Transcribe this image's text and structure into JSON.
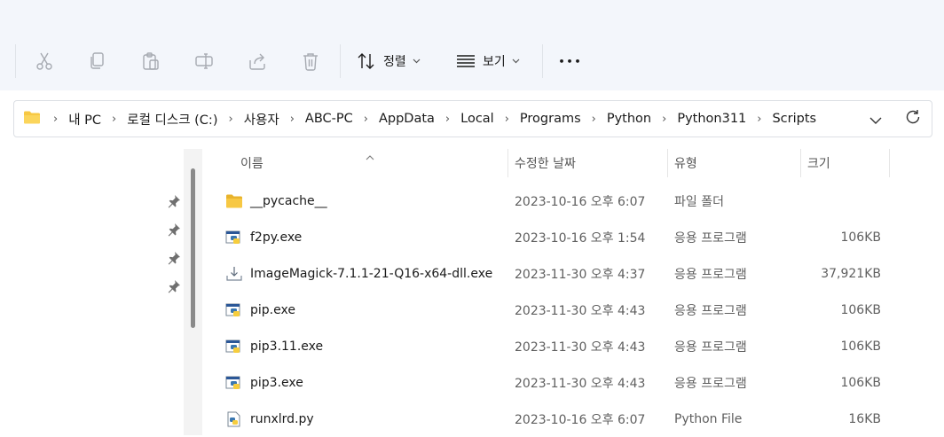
{
  "toolbar": {
    "cut_icon": "scissors-icon",
    "copy_icon": "copy-icon",
    "paste_icon": "clipboard-icon",
    "rename_icon": "rename-icon",
    "share_icon": "share-icon",
    "delete_icon": "trash-icon",
    "sort_label": "정렬",
    "view_label": "보기",
    "more_label": "•••"
  },
  "address": {
    "crumbs": [
      "내 PC",
      "로컬 디스크 (C:)",
      "사용자",
      "ABC-PC",
      "AppData",
      "Local",
      "Programs",
      "Python",
      "Python311",
      "Scripts"
    ],
    "separator": "›"
  },
  "columns": {
    "name": "이름",
    "date": "수정한 날짜",
    "type": "유형",
    "size": "크기"
  },
  "files": [
    {
      "name": "__pycache__",
      "date": "2023-10-16 오후 6:07",
      "type": "파일 폴더",
      "size": "",
      "icon": "folder-icon"
    },
    {
      "name": "f2py.exe",
      "date": "2023-10-16 오후 1:54",
      "type": "응용 프로그램",
      "size": "106KB",
      "icon": "python-exe-icon"
    },
    {
      "name": "ImageMagick-7.1.1-21-Q16-x64-dll.exe",
      "date": "2023-11-30 오후 4:37",
      "type": "응용 프로그램",
      "size": "37,921KB",
      "icon": "installer-icon"
    },
    {
      "name": "pip.exe",
      "date": "2023-11-30 오후 4:43",
      "type": "응용 프로그램",
      "size": "106KB",
      "icon": "python-exe-icon"
    },
    {
      "name": "pip3.11.exe",
      "date": "2023-11-30 오후 4:43",
      "type": "응용 프로그램",
      "size": "106KB",
      "icon": "python-exe-icon"
    },
    {
      "name": "pip3.exe",
      "date": "2023-11-30 오후 4:43",
      "type": "응용 프로그램",
      "size": "106KB",
      "icon": "python-exe-icon"
    },
    {
      "name": "runxlrd.py",
      "date": "2023-10-16 오후 6:07",
      "type": "Python File",
      "size": "16KB",
      "icon": "python-file-icon"
    }
  ],
  "colors": {
    "toolbar_bg": "#f3f6fb",
    "folder_yellow": "#f7c843",
    "accent_blue": "#2b5797",
    "python_yellow": "#f6cd3d"
  }
}
